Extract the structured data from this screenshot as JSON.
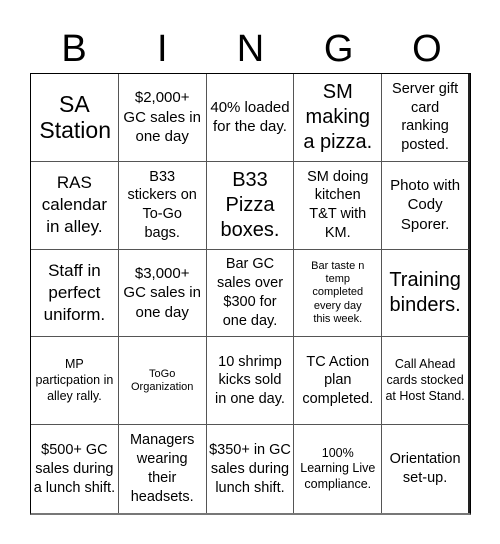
{
  "header": {
    "letters": [
      "B",
      "I",
      "N",
      "G",
      "O"
    ]
  },
  "cells": [
    "SA Station",
    "$2,000+ GC sales in one day",
    "40% loaded for the day.",
    "SM making a pizza.",
    "Server gift card ranking posted.",
    "RAS calendar in alley.",
    "B33 stickers on To-Go bags.",
    "B33 Pizza boxes.",
    "SM doing kitchen T&T with KM.",
    "Photo with Cody Sporer.",
    "Staff in perfect uniform.",
    "$3,000+ GC sales in one day",
    "Bar GC sales over $300 for one day.",
    "Bar taste n temp completed every day this week.",
    "Training binders.",
    "MP particpation in alley rally.",
    "ToGo Organization",
    "10 shrimp kicks sold in one day.",
    "TC Action plan completed.",
    "Call Ahead cards stocked at Host Stand.",
    "$500+ GC sales during a lunch shift.",
    "Managers wearing their headsets.",
    "$350+ in GC sales during lunch shift.",
    "100% Learning Live compliance.",
    "Orientation set-up."
  ]
}
